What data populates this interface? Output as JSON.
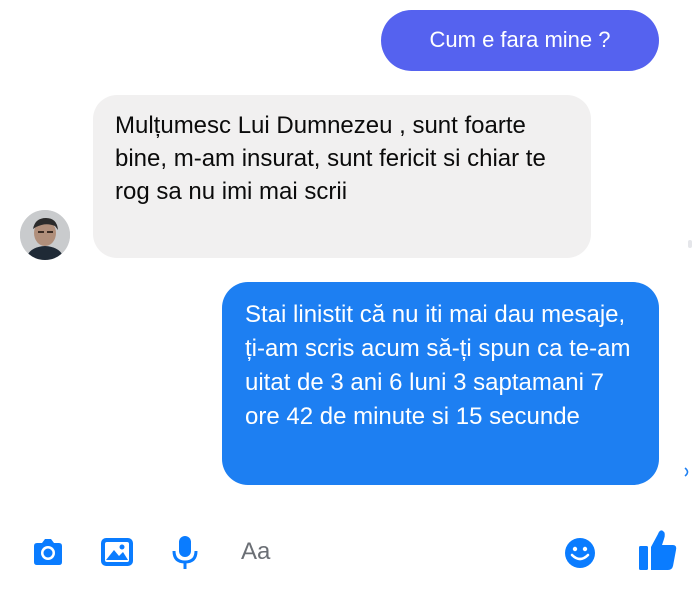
{
  "messages": {
    "sent_1": "Cum e fara mine ?",
    "received_1": "Mulțumesc Lui Dumnezeu  , sunt foarte bine, m-am insurat, sunt fericit si chiar te rog sa nu imi mai scrii",
    "sent_2": "Stai linistit că nu iti mai dau mesaje, ți-am scris acum să-ți spun ca te-am uitat de 3 ani 6 luni 3 saptamani 7 ore 42 de minute si 15 secunde"
  },
  "composer": {
    "placeholder": "Aa",
    "icons": [
      "camera-icon",
      "image-icon",
      "microphone-icon",
      "emoji-icon",
      "thumbs-up-icon"
    ]
  },
  "colors": {
    "sent_bubble_1": "#5562ef",
    "sent_bubble_2": "#1d7ff2",
    "received_bubble": "#f1f0f0",
    "accent": "#0a7cff"
  }
}
